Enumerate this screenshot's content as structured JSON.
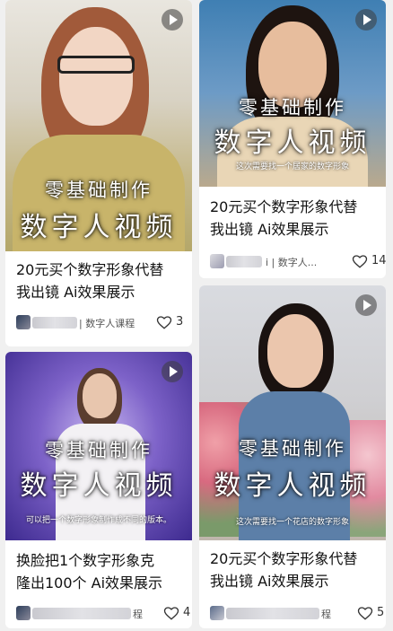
{
  "colors": {
    "page_bg": "#f0f0f0",
    "card_bg": "#ffffff",
    "text": "#111111",
    "meta": "#555555"
  },
  "cards": [
    {
      "overlay_line1": "零基础制作",
      "overlay_line2": "数字人视频",
      "subtitle": "",
      "title_line1": "20元买个数字形象代替",
      "title_line2": "我出镜 Ai效果展示",
      "channel": "| 数字人课程",
      "likes": "3"
    },
    {
      "overlay_line1": "零基础制作",
      "overlay_line2": "数字人视频",
      "subtitle": "这次需要找一个居家的数字形象",
      "title_line1": "20元买个数字形象代替",
      "title_line2": "我出镜 Ai效果展示",
      "channel": "i | 数字人...",
      "likes": "14"
    },
    {
      "overlay_line1": "零基础制作",
      "overlay_line2": "数字人视频",
      "subtitle": "可以把一个数字形象制作成不同的版本。",
      "title_line1": "换脸把1个数字形象克",
      "title_line2": "隆出100个 Ai效果展示",
      "channel": "程",
      "likes": "4"
    },
    {
      "overlay_line1": "零基础制作",
      "overlay_line2": "数字人视频",
      "subtitle": "这次需要找一个花店的数字形象",
      "title_line1": "20元买个数字形象代替",
      "title_line2": "我出镜 Ai效果展示",
      "channel": "程",
      "likes": "5"
    }
  ]
}
